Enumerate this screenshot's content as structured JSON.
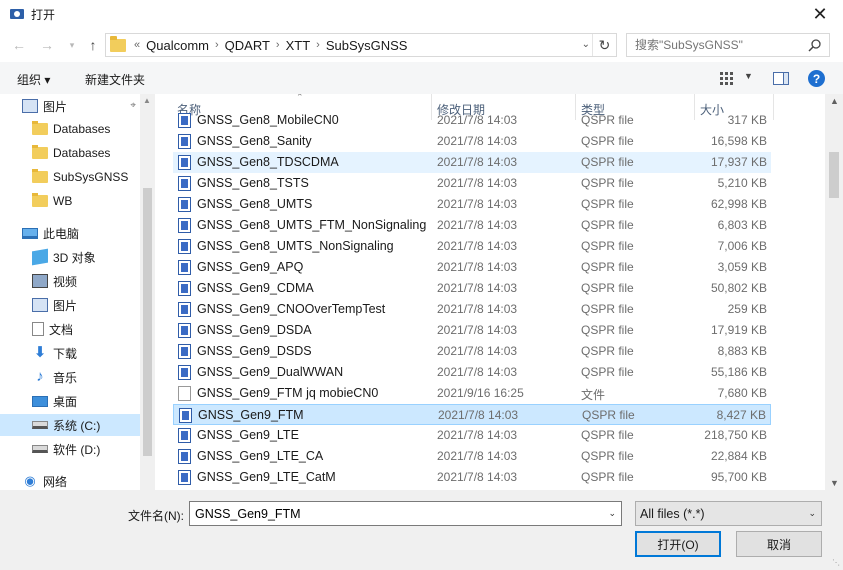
{
  "window": {
    "title": "打开",
    "close": "✕"
  },
  "address": {
    "overflow": "«",
    "crumbs": [
      "Qualcomm",
      "QDART",
      "XTT",
      "SubSysGNSS"
    ],
    "sep": "›"
  },
  "search": {
    "placeholder": "搜索\"SubSysGNSS\""
  },
  "toolbar": {
    "organize": "组织 ▾",
    "new_folder": "新建文件夹",
    "help": "?"
  },
  "nav": [
    {
      "label": "图片",
      "icon": "pictures-icon",
      "pinned": true
    },
    {
      "label": "Databases",
      "icon": "folder-icon"
    },
    {
      "label": "Databases",
      "icon": "folder-icon"
    },
    {
      "label": "SubSysGNSS",
      "icon": "folder-icon"
    },
    {
      "label": "WB",
      "icon": "folder-icon"
    },
    {
      "label": "此电脑",
      "icon": "computer-icon"
    },
    {
      "label": "3D 对象",
      "icon": "3d-objects-icon"
    },
    {
      "label": "视频",
      "icon": "videos-icon"
    },
    {
      "label": "图片",
      "icon": "pictures-icon"
    },
    {
      "label": "文档",
      "icon": "documents-icon"
    },
    {
      "label": "下载",
      "icon": "downloads-icon"
    },
    {
      "label": "音乐",
      "icon": "music-icon"
    },
    {
      "label": "桌面",
      "icon": "desktop-icon"
    },
    {
      "label": "系统 (C:)",
      "icon": "drive-icon",
      "selected": true
    },
    {
      "label": "软件 (D:)",
      "icon": "drive-icon"
    },
    {
      "label": "网络",
      "icon": "network-icon"
    }
  ],
  "columns": {
    "name": "名称",
    "date": "修改日期",
    "type": "类型",
    "size": "大小"
  },
  "files": [
    {
      "name": "GNSS_Gen8_MobileCN0",
      "date": "2021/7/8 14:03",
      "type": "QSPR file",
      "size": "317 KB"
    },
    {
      "name": "GNSS_Gen8_Sanity",
      "date": "2021/7/8 14:03",
      "type": "QSPR file",
      "size": "16,598 KB"
    },
    {
      "name": "GNSS_Gen8_TDSCDMA",
      "date": "2021/7/8 14:03",
      "type": "QSPR file",
      "size": "17,937 KB",
      "state": "hover"
    },
    {
      "name": "GNSS_Gen8_TSTS",
      "date": "2021/7/8 14:03",
      "type": "QSPR file",
      "size": "5,210 KB"
    },
    {
      "name": "GNSS_Gen8_UMTS",
      "date": "2021/7/8 14:03",
      "type": "QSPR file",
      "size": "62,998 KB"
    },
    {
      "name": "GNSS_Gen8_UMTS_FTM_NonSignaling",
      "date": "2021/7/8 14:03",
      "type": "QSPR file",
      "size": "6,803 KB"
    },
    {
      "name": "GNSS_Gen8_UMTS_NonSignaling",
      "date": "2021/7/8 14:03",
      "type": "QSPR file",
      "size": "7,006 KB"
    },
    {
      "name": "GNSS_Gen9_APQ",
      "date": "2021/7/8 14:03",
      "type": "QSPR file",
      "size": "3,059 KB"
    },
    {
      "name": "GNSS_Gen9_CDMA",
      "date": "2021/7/8 14:03",
      "type": "QSPR file",
      "size": "50,802 KB"
    },
    {
      "name": "GNSS_Gen9_CNOOverTempTest",
      "date": "2021/7/8 14:03",
      "type": "QSPR file",
      "size": "259 KB"
    },
    {
      "name": "GNSS_Gen9_DSDA",
      "date": "2021/7/8 14:03",
      "type": "QSPR file",
      "size": "17,919 KB"
    },
    {
      "name": "GNSS_Gen9_DSDS",
      "date": "2021/7/8 14:03",
      "type": "QSPR file",
      "size": "8,883 KB"
    },
    {
      "name": "GNSS_Gen9_DualWWAN",
      "date": "2021/7/8 14:03",
      "type": "QSPR file",
      "size": "55,186 KB"
    },
    {
      "name": "GNSS_Gen9_FTM jq mobieCN0",
      "date": "2021/9/16 16:25",
      "type": "文件",
      "size": "7,680 KB",
      "plain": true
    },
    {
      "name": "GNSS_Gen9_FTM",
      "date": "2021/7/8 14:03",
      "type": "QSPR file",
      "size": "8,427 KB",
      "state": "selected"
    },
    {
      "name": "GNSS_Gen9_LTE",
      "date": "2021/7/8 14:03",
      "type": "QSPR file",
      "size": "218,750 KB"
    },
    {
      "name": "GNSS_Gen9_LTE_CA",
      "date": "2021/7/8 14:03",
      "type": "QSPR file",
      "size": "22,884 KB"
    },
    {
      "name": "GNSS_Gen9_LTE_CatM",
      "date": "2021/7/8 14:03",
      "type": "QSPR file",
      "size": "95,700 KB"
    }
  ],
  "bottom": {
    "filename_label": "文件名(N):",
    "filename_value": "GNSS_Gen9_FTM",
    "filter": "All files (*.*)",
    "open": "打开(O)",
    "cancel": "取消"
  }
}
